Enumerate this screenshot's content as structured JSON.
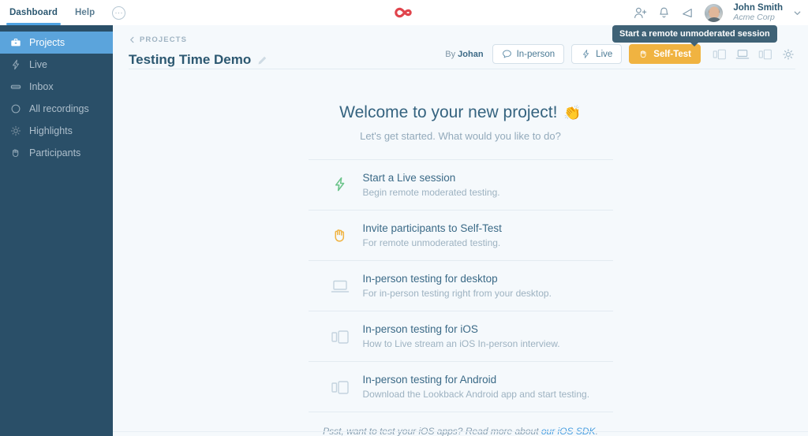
{
  "topbar": {
    "dashboard_label": "Dashboard",
    "help_label": "Help",
    "more_label": "···",
    "logo_name": "lookback-infinity-logo",
    "logo_color": "#e0444c",
    "icons": [
      "add-user-icon",
      "bell-icon",
      "megaphone-icon"
    ],
    "user": {
      "name": "John Smith",
      "org": "Acme Corp"
    }
  },
  "sidebar": {
    "items": [
      {
        "label": "Projects",
        "icon": "briefcase-icon",
        "active": true
      },
      {
        "label": "Live",
        "icon": "lightning-icon",
        "active": false
      },
      {
        "label": "Inbox",
        "icon": "inbox-icon",
        "active": false
      },
      {
        "label": "All recordings",
        "icon": "circle-icon",
        "active": false
      },
      {
        "label": "Highlights",
        "icon": "sun-icon",
        "active": false
      },
      {
        "label": "Participants",
        "icon": "hand-icon",
        "active": false
      }
    ],
    "active_color": "#5ba4dc",
    "bg_color": "#2a4f68"
  },
  "project": {
    "breadcrumb": "PROJECTS",
    "title": "Testing Time Demo",
    "edit_icon": "pencil-icon",
    "byline_prefix": "By",
    "byline_name": "Johan",
    "buttons": [
      {
        "label": "In-person",
        "icon": "speech-bubble-icon",
        "primary": false
      },
      {
        "label": "Live",
        "icon": "lightning-icon",
        "primary": false
      },
      {
        "label": "Self-Test",
        "icon": "hand-icon",
        "primary": true
      }
    ],
    "primary_color": "#f0b341",
    "tool_icons": [
      "devices-icon",
      "laptop-icon",
      "tablet-icon",
      "gear-icon"
    ]
  },
  "tooltip": {
    "text": "Start a remote unmoderated session"
  },
  "welcome": {
    "title": "Welcome to your new project!",
    "emoji": "👏",
    "subtitle": "Let's get started. What would you like to do?",
    "options": [
      {
        "title": "Start a Live session",
        "desc": "Begin remote moderated testing.",
        "icon": "lightning-icon",
        "icon_color": "#6cc48b"
      },
      {
        "title": "Invite participants to Self-Test",
        "desc": "For remote unmoderated testing.",
        "icon": "hand-icon",
        "icon_color": "#f0b341"
      },
      {
        "title": "In-person testing for desktop",
        "desc": "For in-person testing right from your desktop.",
        "icon": "laptop-icon",
        "icon_color": "#c3d3de"
      },
      {
        "title": "In-person testing for iOS",
        "desc": "How to Live stream an iOS In-person interview.",
        "icon": "devices-icon",
        "icon_color": "#c3d3de"
      },
      {
        "title": "In-person testing for Android",
        "desc": "Download the Lookback Android app and start testing.",
        "icon": "devices-icon",
        "icon_color": "#c3d3de"
      }
    ],
    "footer_text": "Psst, want to test your iOS apps? Read more about ",
    "footer_link": "our iOS SDK",
    "footer_end": "."
  }
}
